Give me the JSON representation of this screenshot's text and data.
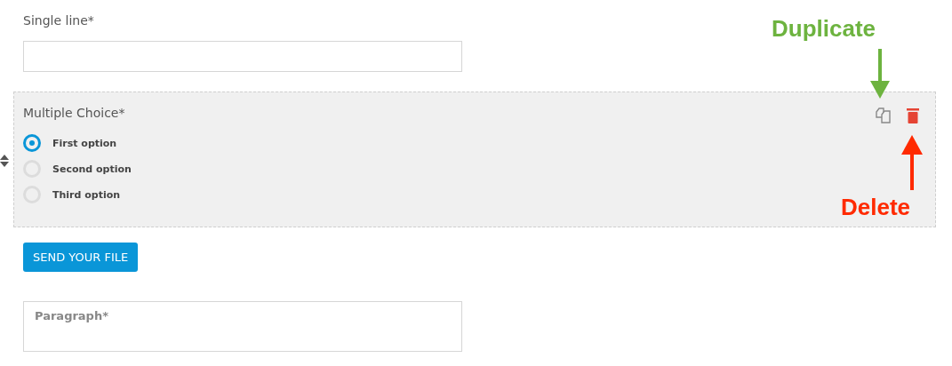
{
  "single_line": {
    "label": "Single line*"
  },
  "multiple_choice": {
    "label": "Multiple Choice*",
    "options": [
      {
        "label": "First option",
        "selected": true
      },
      {
        "label": "Second option",
        "selected": false
      },
      {
        "label": "Third option",
        "selected": false
      }
    ]
  },
  "send_button": "SEND YOUR FILE",
  "paragraph": {
    "placeholder": "Paragraph*"
  },
  "annotations": [
    {
      "kind": "duplicate",
      "text": "Duplicate",
      "color": "#6db33f"
    },
    {
      "kind": "delete",
      "text": "Delete",
      "color": "#ff2a00"
    }
  ]
}
